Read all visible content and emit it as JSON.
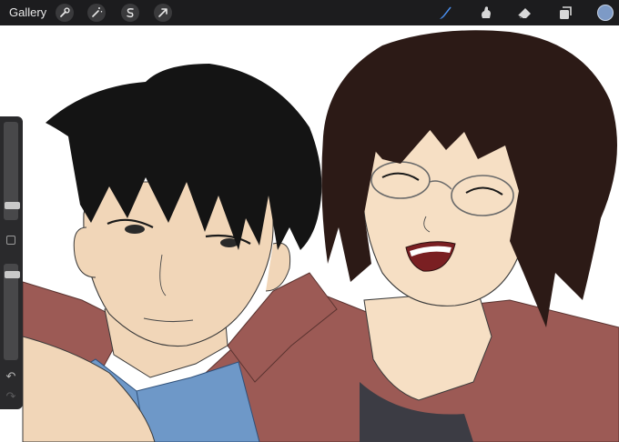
{
  "toolbar": {
    "gallery_label": "Gallery",
    "left_tools": [
      "wrench-icon",
      "magic-wand-icon",
      "selection-s-icon",
      "transform-arrow-icon"
    ],
    "right_tools": [
      "brush-icon",
      "smudge-icon",
      "eraser-icon",
      "layers-icon"
    ],
    "active_tool": "brush-icon",
    "active_tool_color": "#4a8ff0",
    "current_color": "#7d9ac6"
  },
  "sidebar": {
    "brush_size_level": 0.12,
    "opacity_level": 0.92,
    "modifier_icon": "square-modifier-icon",
    "undo_icon": "undo-arrow-icon",
    "redo_icon": "redo-arrow-icon"
  },
  "canvas": {
    "colors": {
      "background": "#ffffff",
      "skin": "#f1d6b8",
      "skin_right": "#f6dfc4",
      "hair_left": "#141414",
      "hair_right": "#2c1a16",
      "jacket": "#9c5a55",
      "shirt": "#6e98c8",
      "line": "#3a3a3a"
    }
  }
}
